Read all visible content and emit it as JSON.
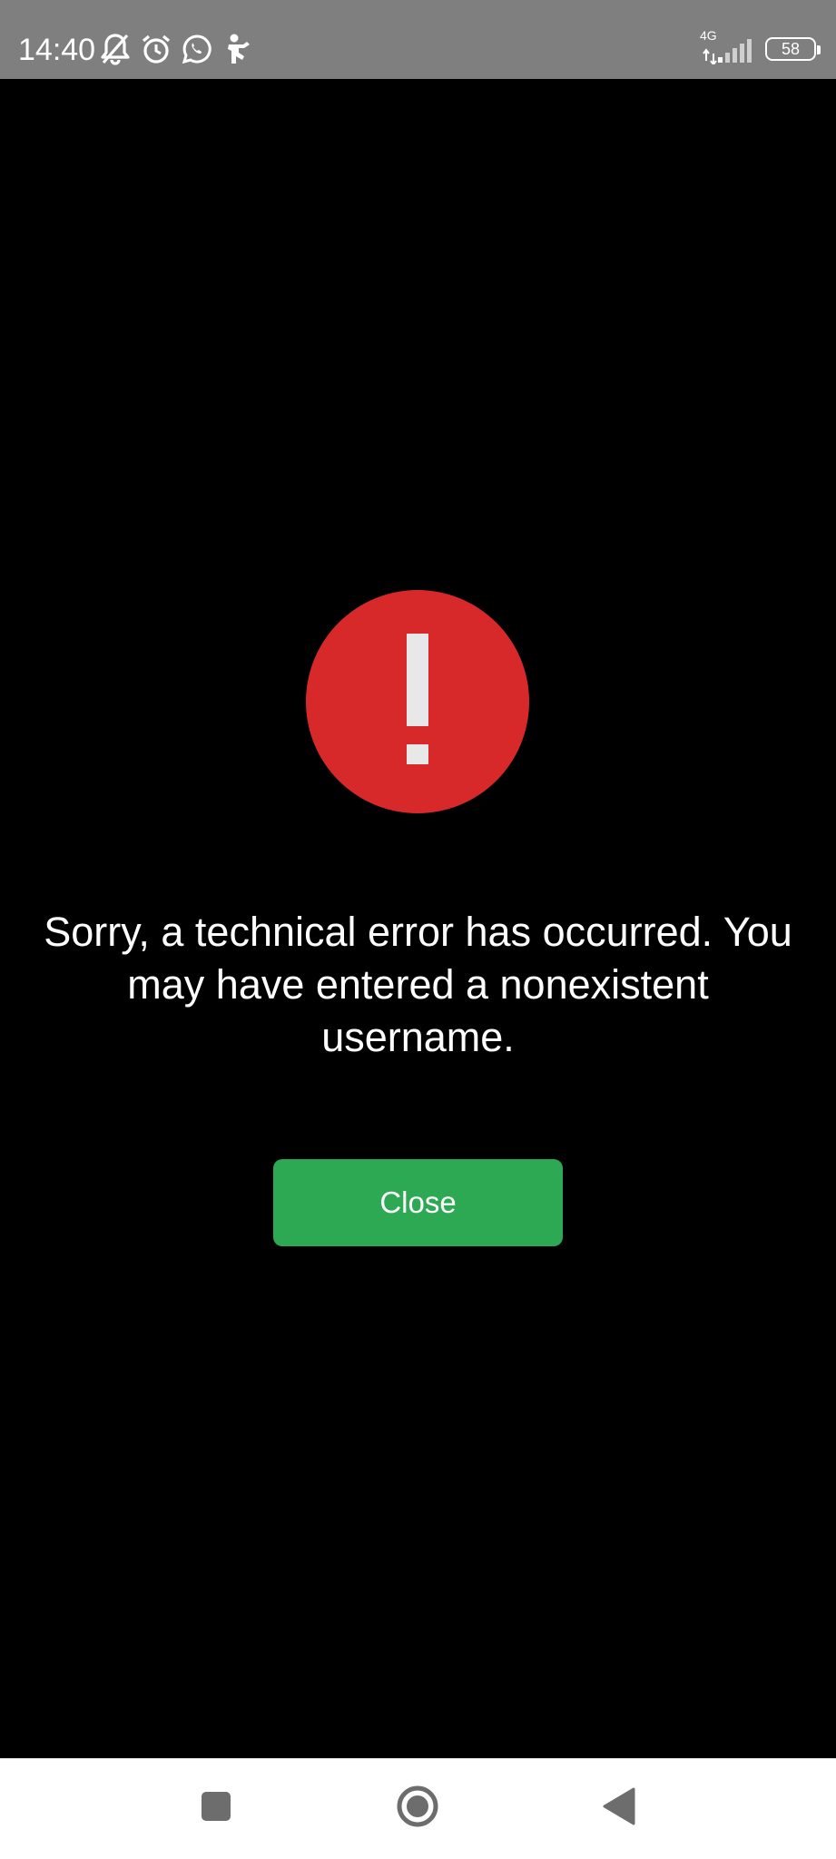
{
  "status_bar": {
    "time": "14:40",
    "network_type": "4G",
    "battery_level": "58",
    "icons": [
      "bell-off-icon",
      "alarm-icon",
      "whatsapp-icon",
      "accessibility-icon",
      "signal-icon",
      "battery-icon"
    ]
  },
  "dialog": {
    "icon": "error-exclamation-icon",
    "icon_color": "#d7292a",
    "message": "Sorry, a technical error has occurred. You may have entered a nonexistent username.",
    "close_label": "Close",
    "button_color": "#2ea953"
  },
  "navigation_bar": {
    "buttons": [
      "recents-icon",
      "home-icon",
      "back-icon"
    ]
  }
}
